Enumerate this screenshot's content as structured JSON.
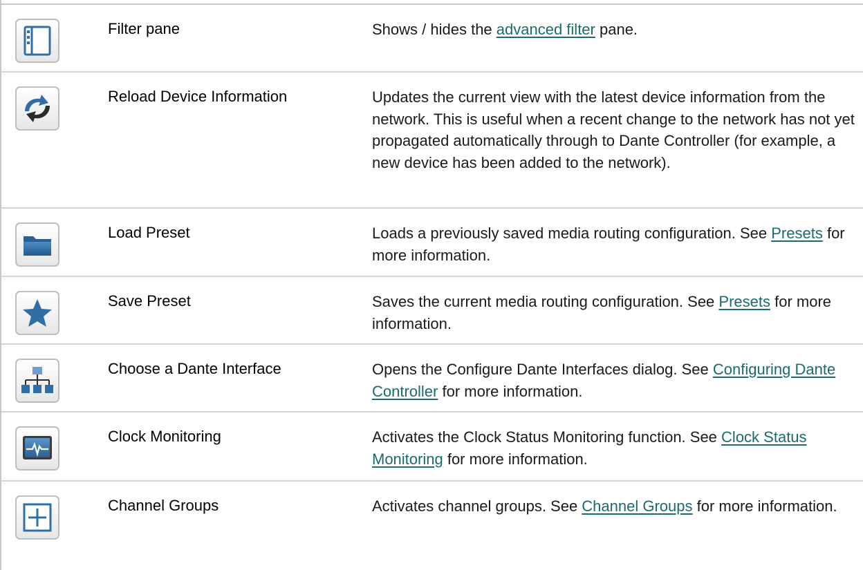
{
  "rows": [
    {
      "icon": "filter-pane-icon",
      "name": "Filter pane",
      "desc_pre": "Shows / hides the ",
      "link": "advanced filter",
      "desc_post": " pane."
    },
    {
      "icon": "reload-arrows-icon",
      "name": "Reload Device Information",
      "desc_pre": "Updates the current view with the latest device information from the network. This is useful when a recent change to the network has not yet propagated automatically through to Dante Controller (for example, a new device has been added to the network).",
      "link": "",
      "desc_post": ""
    },
    {
      "icon": "folder-icon",
      "name": "Load Preset",
      "desc_pre": "Loads a previously saved media routing configuration. See ",
      "link": "Presets",
      "desc_post": " for more information."
    },
    {
      "icon": "star-icon",
      "name": "Save Preset",
      "desc_pre": "Saves the current media routing configuration. See ",
      "link": "Presets",
      "desc_post": " for more information."
    },
    {
      "icon": "network-tree-icon",
      "name": "Choose a Dante Interface",
      "desc_pre": "Opens the Configure Dante Interfaces dialog. See ",
      "link": "Configuring Dante Controller",
      "desc_post": " for more information."
    },
    {
      "icon": "clock-monitor-icon",
      "name": "Clock Monitoring",
      "desc_pre": "Activates the Clock Status Monitoring function. See ",
      "link": "Clock Status Monitoring",
      "desc_post": " for more information."
    },
    {
      "icon": "plus-box-icon",
      "name": "Channel Groups",
      "desc_pre": "Activates channel groups. See ",
      "link": "Channel Groups",
      "desc_post": " for more information."
    }
  ],
  "colors": {
    "link": "#1a6b6b",
    "icon_blue": "#2f6fa6",
    "border": "#c8c8c8"
  }
}
